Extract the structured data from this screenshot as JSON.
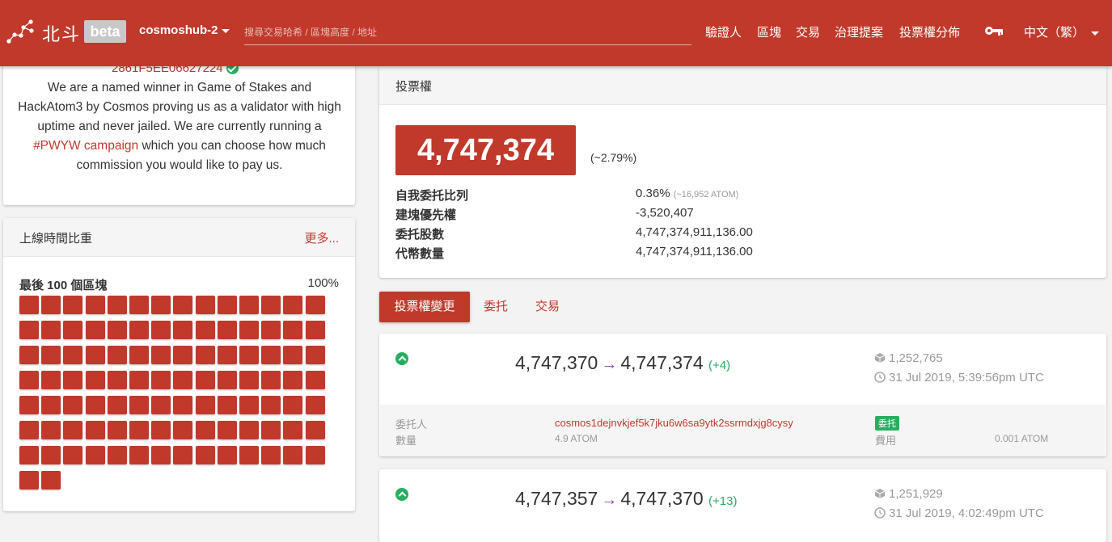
{
  "header": {
    "brand": "北斗",
    "beta": "beta",
    "chain": "cosmoshub-2",
    "search_placeholder": "搜尋交易哈希 / 區塊高度 / 地址",
    "nav": [
      "驗證人",
      "區塊",
      "交易",
      "治理提案",
      "投票權分佈"
    ],
    "language": "中文（繁）"
  },
  "profile": {
    "address_fragment": "2861F5EE06627224",
    "description_before": "We are a named winner in Game of Stakes and HackAtom3 by Cosmos proving us as a validator with high uptime and never jailed. We are currently running a ",
    "campaign_link": "#PWYW campaign",
    "description_after": " which you can choose how much commission you would like to pay us."
  },
  "uptime": {
    "title": "上線時間比重",
    "more": "更多...",
    "label": "最後 100 個區塊",
    "percent": "100%",
    "blocks_count": 100
  },
  "voting_power": {
    "title": "投票權",
    "value": "4,747,374",
    "percent": "(~2.79%)",
    "rows": [
      {
        "label": "自我委托比列",
        "value": "0.36%",
        "sub": "(~16,952 ATOM)"
      },
      {
        "label": "建塊優先權",
        "value": "-3,520,407",
        "sub": ""
      },
      {
        "label": "委托股數",
        "value": "4,747,374,911,136.00",
        "sub": ""
      },
      {
        "label": "代幣數量",
        "value": "4,747,374,911,136.00",
        "sub": ""
      }
    ]
  },
  "tabs": [
    "投票權變更",
    "委托",
    "交易"
  ],
  "changes": [
    {
      "from": "4,747,370",
      "to": "4,747,374",
      "delta": "(+4)",
      "height": "1,252,765",
      "time": "31 Jul 2019, 5:39:56pm UTC",
      "delegator_label": "委托人",
      "amount_label": "數量",
      "delegator": "cosmos1dejnvkjef5k7jku6w6sa9ytk2ssrmdxjg8cysy",
      "amount": "4.9 ATOM",
      "type_badge": "委托",
      "fee_label": "費用",
      "fee": "0.001 ATOM"
    },
    {
      "from": "4,747,357",
      "to": "4,747,370",
      "delta": "(+13)",
      "height": "1,251,929",
      "time": "31 Jul 2019, 4:02:49pm UTC"
    }
  ]
}
